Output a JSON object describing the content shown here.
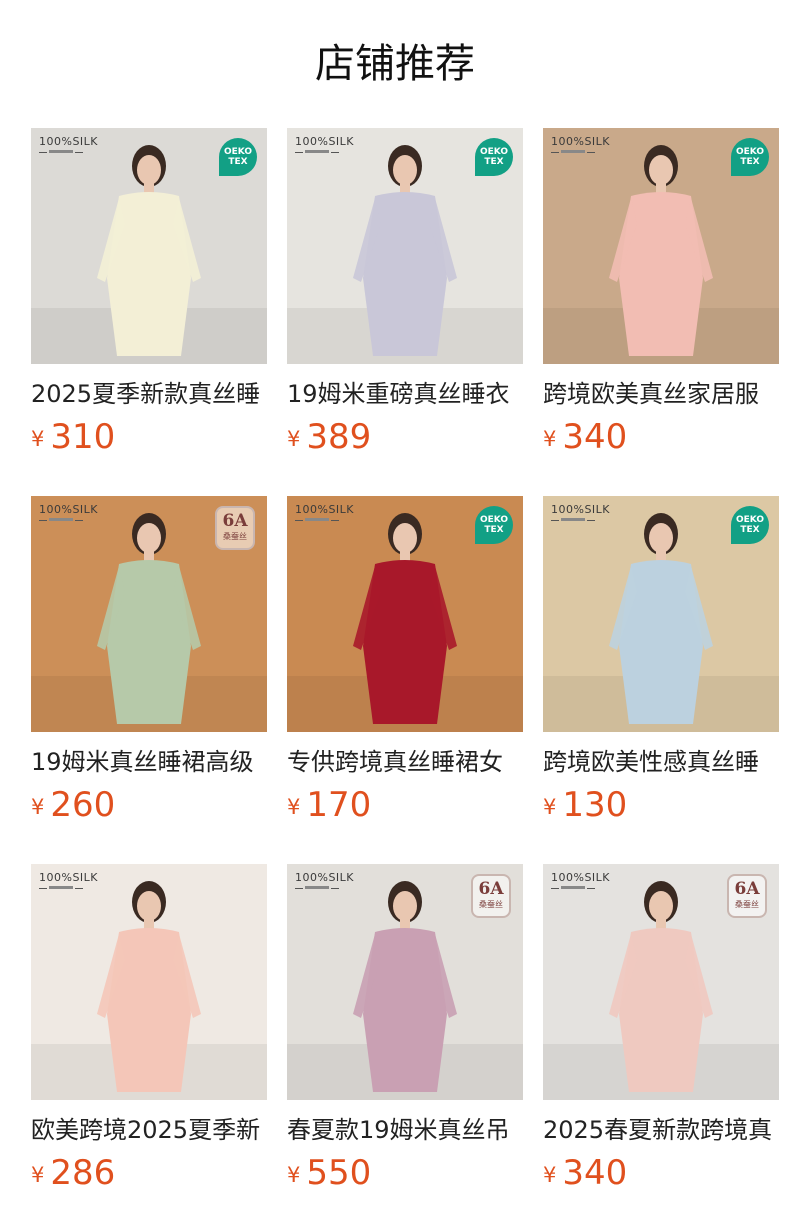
{
  "page_title": "店铺推荐",
  "currency_symbol": "¥",
  "badges": {
    "silk_main": "100%SILK",
    "oeko_line1": "OEKO",
    "oeko_line2": "TEX",
    "grade_big": "6A",
    "grade_sub": "桑蚕丝"
  },
  "products": [
    {
      "name": "2025夏季新款真丝睡",
      "price": "310",
      "badge": "oeko",
      "color": "#f3efd6",
      "bg": "#dcdad6"
    },
    {
      "name": "19姆米重磅真丝睡衣",
      "price": "389",
      "badge": "oeko",
      "color": "#c9c7d8",
      "bg": "#e6e4df"
    },
    {
      "name": "跨境欧美真丝家居服",
      "price": "340",
      "badge": "oeko",
      "color": "#f2bdb3",
      "bg": "#c9a98a"
    },
    {
      "name": "19姆米真丝睡裙高级",
      "price": "260",
      "badge": "grade",
      "color": "#b6c9a9",
      "bg": "#cc8f58"
    },
    {
      "name": "专供跨境真丝睡裙女",
      "price": "170",
      "badge": "oeko",
      "color": "#a8182a",
      "bg": "#c98a52"
    },
    {
      "name": "跨境欧美性感真丝睡",
      "price": "130",
      "badge": "oeko",
      "color": "#bcd1df",
      "bg": "#dcc8a4"
    },
    {
      "name": "欧美跨境2025夏季新",
      "price": "286",
      "badge": "none",
      "color": "#f4c6b8",
      "bg": "#efe9e3"
    },
    {
      "name": "春夏款19姆米真丝吊",
      "price": "550",
      "badge": "grade",
      "color": "#c9a0b3",
      "bg": "#e2dfda"
    },
    {
      "name": "2025春夏新款跨境真",
      "price": "340",
      "badge": "grade",
      "color": "#efc9c0",
      "bg": "#e4e2df"
    }
  ]
}
